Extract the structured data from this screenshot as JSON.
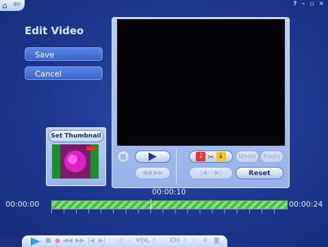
{
  "window": {
    "controls": "? – ▫ ✕"
  },
  "page": {
    "title": "Edit Video"
  },
  "menu": {
    "save": "Save",
    "cancel": "Cancel"
  },
  "thumbnail": {
    "button": "Set Thumbnail"
  },
  "editor": {
    "undo": "Undo",
    "redo": "Redo",
    "reset": "Reset"
  },
  "timeline": {
    "current": "00:00:10",
    "start": "00:00:00",
    "end": "00:00:24",
    "position_fraction": 0.42
  },
  "bottom_bar": {
    "vol": "VOL",
    "ch": "CH"
  },
  "colors": {
    "background": "#203a94",
    "panel": "#aec4f0",
    "timeline": "#5bc057"
  }
}
